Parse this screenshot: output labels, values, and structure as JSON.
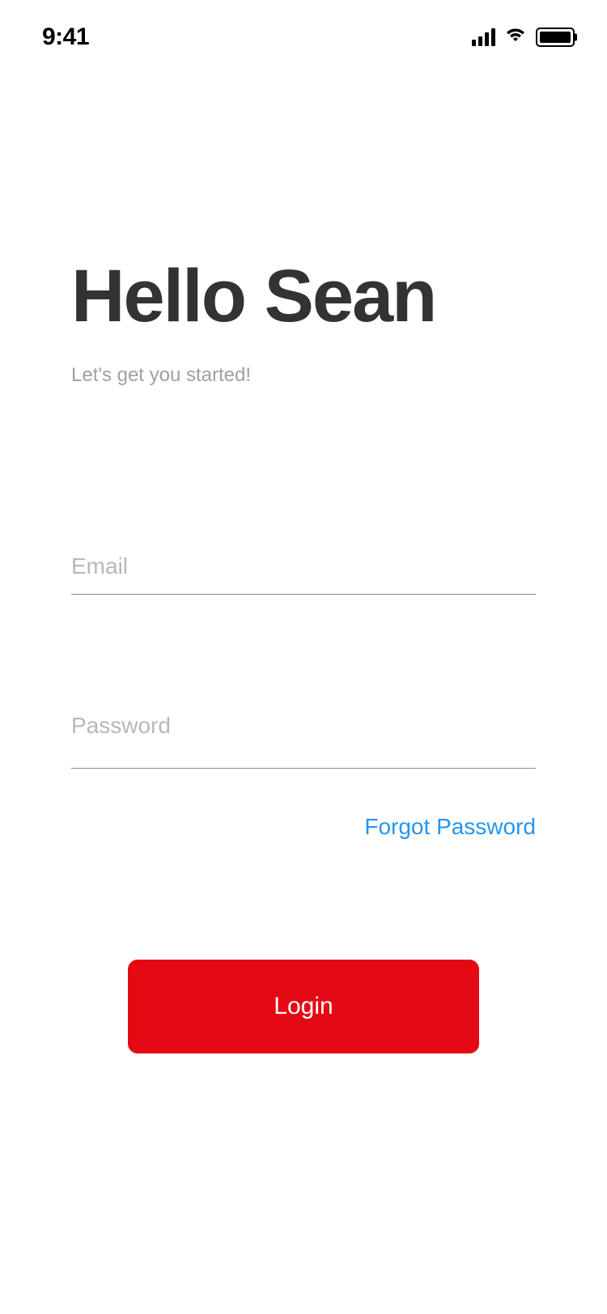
{
  "status_bar": {
    "time": "9:41"
  },
  "header": {
    "greeting": "Hello Sean",
    "subtitle": "Let's get you started!"
  },
  "form": {
    "email_placeholder": "Email",
    "email_value": "",
    "password_placeholder": "Password",
    "password_value": "",
    "forgot_link": "Forgot Password",
    "login_button": "Login"
  }
}
